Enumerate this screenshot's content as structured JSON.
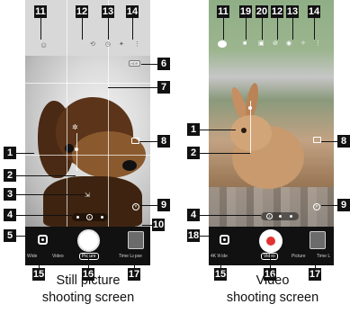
{
  "still_screen": {
    "modes": [
      "Wide",
      "Video",
      "Picture",
      "Time Lapse"
    ],
    "active_mode": "Picture",
    "hdr_label": "HDR",
    "icons": [
      "smile-icon",
      "camera-switch-icon",
      "timer-icon",
      "magic-icon",
      "more-icon",
      "hdr-icon",
      "aspect-icon",
      "focus-icon",
      "brightness-icon",
      "close-icon",
      "google-lens-icon",
      "shutter-icon",
      "thumbnail-icon"
    ]
  },
  "video_screen": {
    "modes": [
      "4K Wide",
      "Video",
      "Picture",
      "Time L"
    ],
    "active_mode": "Video",
    "icons": [
      "record-indicator-icon",
      "video-camera-icon",
      "timer-icon",
      "hdr-icon",
      "magic-icon",
      "more-icon",
      "aspect-icon",
      "close-icon",
      "google-lens-icon",
      "record-button-icon",
      "thumbnail-icon"
    ]
  },
  "callouts": {
    "c1": "1",
    "c2": "2",
    "c3": "3",
    "c4": "4",
    "c5": "5",
    "c6": "6",
    "c7": "7",
    "c8": "8",
    "c9": "9",
    "c10": "10",
    "c11": "11",
    "c12": "12",
    "c13": "13",
    "c14": "14",
    "c15": "15",
    "c16": "16",
    "c17": "17",
    "c18": "18",
    "c19": "19",
    "c20": "20"
  },
  "captions": {
    "still_line1": "Still picture",
    "still_line2": "shooting screen",
    "video_line1": "Video",
    "video_line2": "shooting screen"
  }
}
